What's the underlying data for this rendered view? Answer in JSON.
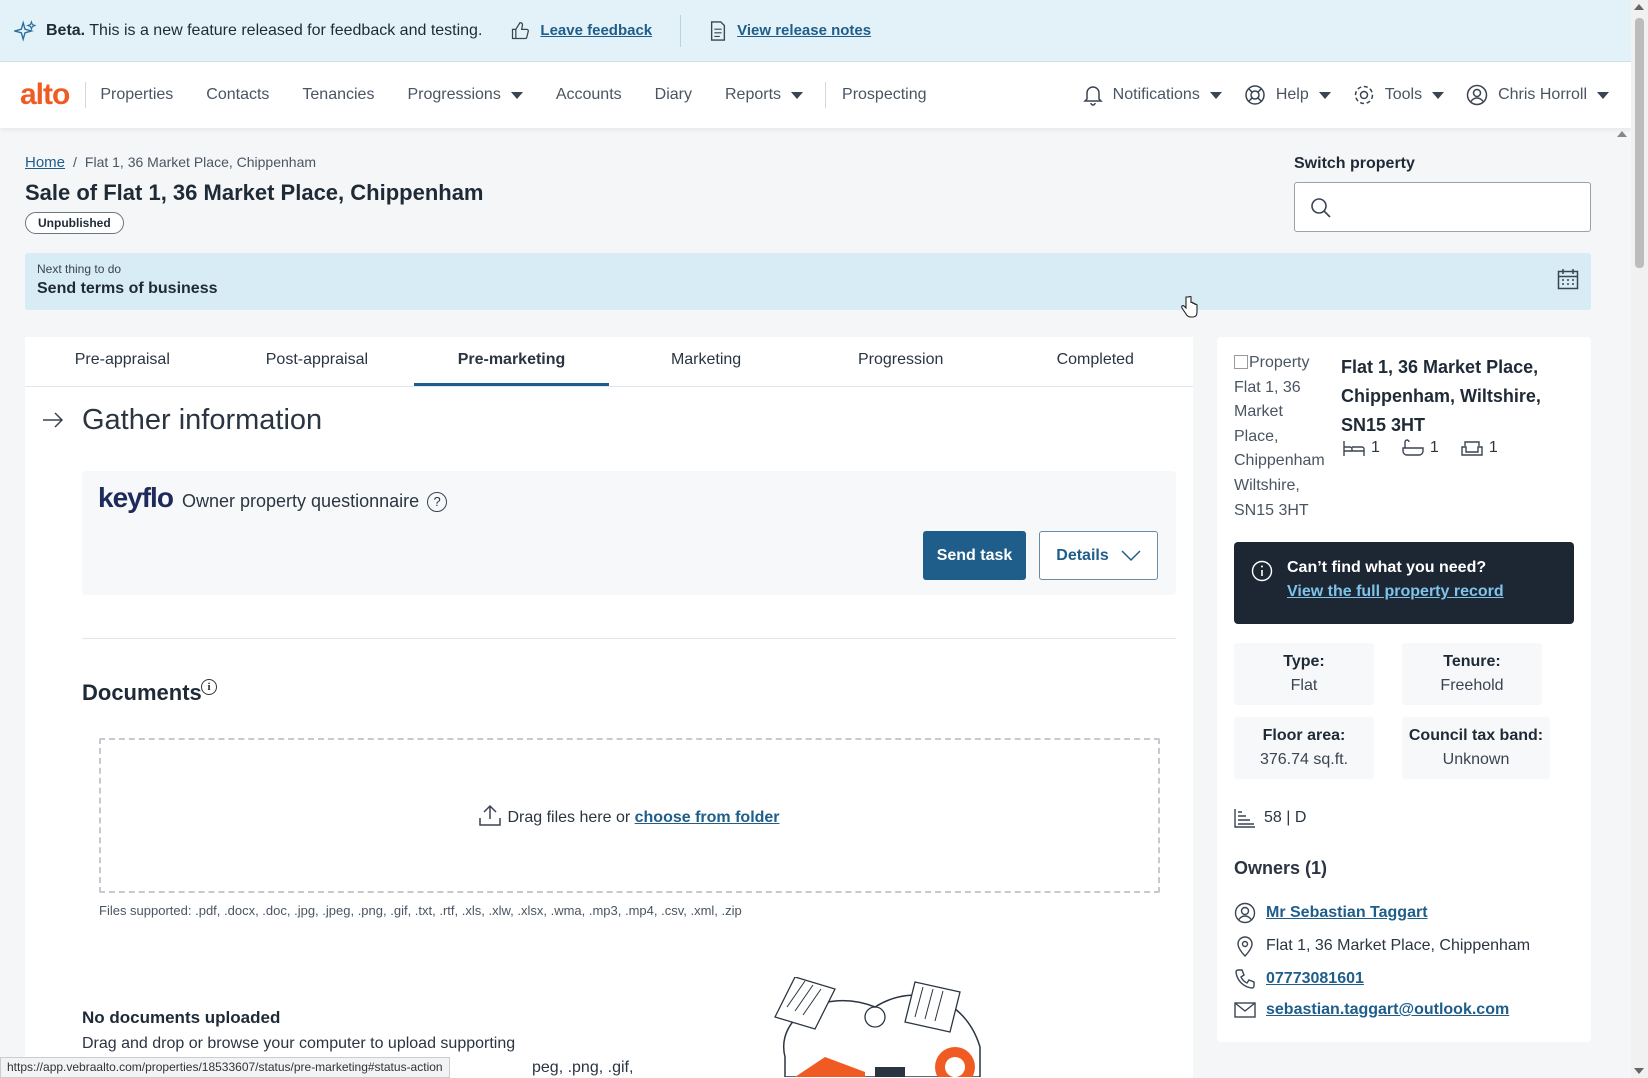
{
  "beta": {
    "label": "Beta.",
    "text": "This is a new feature released for feedback and testing.",
    "feedback": "Leave feedback",
    "release_notes": "View release notes"
  },
  "nav": {
    "logo": "alto",
    "items": [
      "Properties",
      "Contacts",
      "Tenancies",
      "Progressions",
      "Accounts",
      "Diary",
      "Reports",
      "Prospecting"
    ],
    "notifications": "Notifications",
    "help": "Help",
    "tools": "Tools",
    "user": "Chris Horroll"
  },
  "breadcrumb": {
    "home": "Home",
    "current": "Flat 1, 36 Market Place, Chippenham"
  },
  "page": {
    "title": "Sale of Flat 1, 36 Market Place, Chippenham",
    "badge": "Unpublished"
  },
  "switch_property": {
    "label": "Switch property",
    "placeholder": ""
  },
  "next_thing": {
    "label": "Next thing to do",
    "value": "Send terms of business"
  },
  "tabs": [
    "Pre-appraisal",
    "Post-appraisal",
    "Pre-marketing",
    "Marketing",
    "Progression",
    "Completed"
  ],
  "gather": {
    "title": "Gather information",
    "keyflo_logo": "keyflo",
    "questionnaire": "Owner property questionnaire",
    "send_task": "Send task",
    "details": "Details"
  },
  "documents": {
    "title": "Documents",
    "drop_text": "Drag files here or",
    "choose_link": "choose from folder",
    "supported": "Files supported: .pdf, .docx, .doc, .jpg, .jpeg, .png, .gif, .txt, .rtf, .xls, .xlw, .xlsx, .wma, .mp3, .mp4, .csv, .xml, .zip",
    "none_title": "No documents uploaded",
    "none_text": "Drag and drop or browse your computer to upload supporting",
    "none_text2": "peg, .png, .gif,"
  },
  "property": {
    "img_alt": "Property Flat 1, 36 Market Place, Chippenham Wiltshire, SN15 3HT",
    "address": "Flat 1, 36 Market Place, Chippenham, Wiltshire, SN15 3HT",
    "bedrooms": "1",
    "bathrooms": "1",
    "receptions": "1",
    "cant_find_title": "Can’t find what you need?",
    "cant_find_link": "View the full property record",
    "type_label": "Type:",
    "type_value": "Flat",
    "tenure_label": "Tenure:",
    "tenure_value": "Freehold",
    "floor_label": "Floor area:",
    "floor_value": "376.74 sq.ft.",
    "council_label": "Council tax band:",
    "council_value": "Unknown",
    "epc": "58 | D"
  },
  "owners": {
    "title": "Owners (1)",
    "name": "Mr Sebastian Taggart",
    "address": "Flat 1, 36 Market Place, Chippenham",
    "phone": "07773081601",
    "email": "sebastian.taggart@outlook.com"
  },
  "status_url": "https://app.vebraalto.com/properties/18533607/status/pre-marketing#status-action",
  "colors": {
    "brand": "#f05a23",
    "primary": "#1f5d8a",
    "banner": "#e3f2f8",
    "dark_panel": "#1d2733"
  }
}
